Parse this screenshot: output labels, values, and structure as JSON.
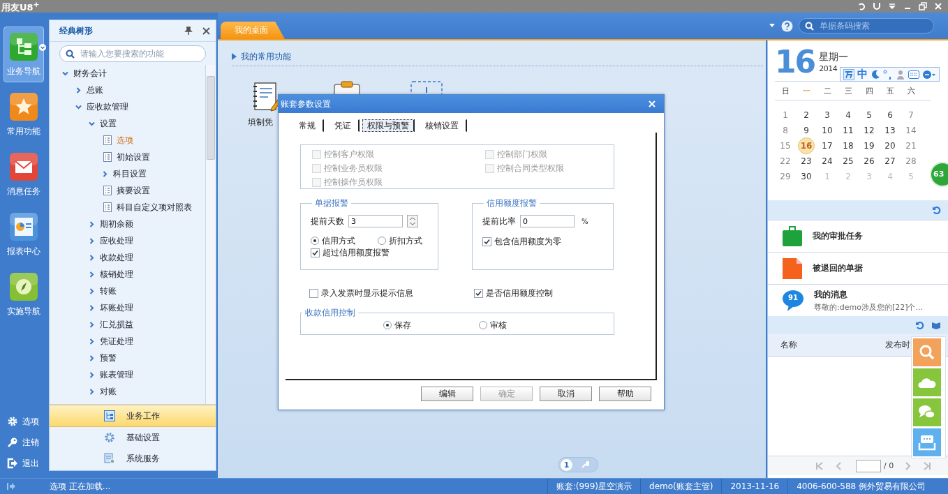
{
  "app": {
    "logo": "用友U8$^{+}$"
  },
  "left_rail": {
    "items": [
      {
        "label": "业务导航",
        "selected": true
      },
      {
        "label": "常用功能",
        "selected": false
      },
      {
        "label": "消息任务",
        "selected": false
      },
      {
        "label": "报表中心",
        "selected": false
      },
      {
        "label": "实施导航",
        "selected": false
      }
    ],
    "bottom": [
      {
        "label": "选项"
      },
      {
        "label": "注销"
      },
      {
        "label": "退出"
      }
    ]
  },
  "tree_panel": {
    "title": "经典树形",
    "search": {
      "placeholder": "请输入您要搜索的功能"
    },
    "tree": [
      {
        "label": "财务会计",
        "kind": "folder",
        "expanded": true,
        "selected": false,
        "children": [
          {
            "label": "总账",
            "kind": "folder",
            "expanded": false,
            "selected": false
          },
          {
            "label": "应收款管理",
            "kind": "folder",
            "expanded": true,
            "selected": false,
            "children": [
              {
                "label": "设置",
                "kind": "folder",
                "expanded": true,
                "selected": false,
                "children": [
                  {
                    "label": "选项",
                    "kind": "doc",
                    "selected": true
                  },
                  {
                    "label": "初始设置",
                    "kind": "doc",
                    "selected": false
                  },
                  {
                    "label": "科目设置",
                    "kind": "folder",
                    "expanded": false,
                    "selected": false
                  },
                  {
                    "label": "摘要设置",
                    "kind": "doc",
                    "selected": false
                  },
                  {
                    "label": "科目自定义项对照表",
                    "kind": "doc",
                    "selected": false
                  }
                ]
              },
              {
                "label": "期初余额",
                "kind": "folder",
                "expanded": false,
                "selected": false
              },
              {
                "label": "应收处理",
                "kind": "folder",
                "expanded": false,
                "selected": false
              },
              {
                "label": "收款处理",
                "kind": "folder",
                "expanded": false,
                "selected": false
              },
              {
                "label": "核销处理",
                "kind": "folder",
                "expanded": false,
                "selected": false
              },
              {
                "label": "转账",
                "kind": "folder",
                "expanded": false,
                "selected": false
              },
              {
                "label": "坏账处理",
                "kind": "folder",
                "expanded": false,
                "selected": false
              },
              {
                "label": "汇兑损益",
                "kind": "folder",
                "expanded": false,
                "selected": false
              },
              {
                "label": "凭证处理",
                "kind": "folder",
                "expanded": false,
                "selected": false
              },
              {
                "label": "预警",
                "kind": "folder",
                "expanded": false,
                "selected": false
              },
              {
                "label": "账表管理",
                "kind": "folder",
                "expanded": false,
                "selected": false
              },
              {
                "label": "对账",
                "kind": "folder",
                "expanded": false,
                "selected": false
              }
            ]
          }
        ]
      }
    ],
    "sections": [
      {
        "label": "业务工作",
        "selected": true
      },
      {
        "label": "基础设置",
        "selected": false
      },
      {
        "label": "系统服务",
        "selected": false
      }
    ]
  },
  "top_bar": {
    "tabs": [
      {
        "label": "我的桌面",
        "selected": true
      }
    ],
    "search": {
      "placeholder": "单据条码搜索"
    }
  },
  "desktop": {
    "header": "我的常用功能",
    "shortcuts": [
      {
        "kind": "document",
        "label": "填制凭"
      },
      {
        "kind": "clipboard"
      },
      {
        "kind": "empty-slot"
      }
    ],
    "pages": [
      {
        "label": "1",
        "selected": true
      }
    ]
  },
  "calendar": {
    "day": "16",
    "weekday": "星期一",
    "month": "2014",
    "weekdays": [
      {
        "label": "日",
        "today": false
      },
      {
        "label": "一",
        "today": true
      },
      {
        "label": "二",
        "today": false
      },
      {
        "label": "三",
        "today": false
      },
      {
        "label": "四",
        "today": false
      },
      {
        "label": "五",
        "today": false
      },
      {
        "label": "六",
        "today": false
      }
    ],
    "days": [
      {
        "label": "1",
        "in_month": true,
        "selected": false
      },
      {
        "label": "2",
        "in_month": true,
        "selected": false
      },
      {
        "label": "3",
        "in_month": true,
        "selected": false
      },
      {
        "label": "4",
        "in_month": true,
        "selected": false
      },
      {
        "label": "5",
        "in_month": true,
        "selected": false
      },
      {
        "label": "6",
        "in_month": true,
        "selected": false
      },
      {
        "label": "7",
        "in_month": true,
        "selected": false
      },
      {
        "label": "8",
        "in_month": true,
        "selected": false
      },
      {
        "label": "9",
        "in_month": true,
        "selected": false
      },
      {
        "label": "10",
        "in_month": true,
        "selected": false
      },
      {
        "label": "11",
        "in_month": true,
        "selected": false
      },
      {
        "label": "12",
        "in_month": true,
        "selected": false
      },
      {
        "label": "13",
        "in_month": true,
        "selected": false
      },
      {
        "label": "14",
        "in_month": true,
        "selected": false
      },
      {
        "label": "15",
        "in_month": true,
        "selected": false
      },
      {
        "label": "16",
        "in_month": true,
        "selected": true
      },
      {
        "label": "17",
        "in_month": true,
        "selected": false
      },
      {
        "label": "18",
        "in_month": true,
        "selected": false
      },
      {
        "label": "19",
        "in_month": true,
        "selected": false
      },
      {
        "label": "20",
        "in_month": true,
        "selected": false
      },
      {
        "label": "21",
        "in_month": true,
        "selected": false
      },
      {
        "label": "22",
        "in_month": true,
        "selected": false
      },
      {
        "label": "23",
        "in_month": true,
        "selected": false
      },
      {
        "label": "24",
        "in_month": true,
        "selected": false
      },
      {
        "label": "25",
        "in_month": true,
        "selected": false
      },
      {
        "label": "26",
        "in_month": true,
        "selected": false
      },
      {
        "label": "27",
        "in_month": true,
        "selected": false
      },
      {
        "label": "28",
        "in_month": true,
        "selected": false
      },
      {
        "label": "29",
        "in_month": true,
        "selected": false
      },
      {
        "label": "30",
        "in_month": true,
        "selected": false
      },
      {
        "label": "1",
        "in_month": false,
        "selected": false
      },
      {
        "label": "2",
        "in_month": false,
        "selected": false
      },
      {
        "label": "3",
        "in_month": false,
        "selected": false
      },
      {
        "label": "4",
        "in_month": false,
        "selected": false
      },
      {
        "label": "5",
        "in_month": false,
        "selected": false
      }
    ]
  },
  "ime_bar": {
    "mode": "中"
  },
  "float_badge": "63",
  "tasks": [
    {
      "kind": "approval",
      "title": "我的审批任务"
    },
    {
      "kind": "returned",
      "title": "被退回的单据"
    },
    {
      "kind": "message",
      "title": "我的消息",
      "count": "91",
      "subtitle": "尊敬的:demo涉及您的[22]个..."
    }
  ],
  "notices": {
    "columns": [
      "名称",
      "发布时"
    ],
    "total": "/ 0"
  },
  "dialog": {
    "title": "账套参数设置",
    "tabs": [
      {
        "label": "常规",
        "selected": false
      },
      {
        "label": "凭证",
        "selected": false
      },
      {
        "label": "权限与预警",
        "selected": true
      },
      {
        "label": "核销设置",
        "selected": false
      }
    ],
    "permissions": [
      {
        "label": "控制客户权限",
        "checked": false,
        "disabled": true
      },
      {
        "label": "控制部门权限",
        "checked": false,
        "disabled": true
      },
      {
        "label": "控制业务员权限",
        "checked": false,
        "disabled": true
      },
      {
        "label": "控制合同类型权限",
        "checked": false,
        "disabled": true
      },
      {
        "label": "控制操作员权限",
        "checked": false,
        "disabled": true
      }
    ],
    "doc_alert": {
      "title": "单据报警",
      "field_label": "提前天数",
      "value": "3",
      "radios": [
        {
          "label": "信用方式",
          "selected": true
        },
        {
          "label": "折扣方式",
          "selected": false
        }
      ],
      "check": {
        "label": "超过信用额度报警",
        "checked": true
      }
    },
    "credit_alert": {
      "title": "信用额度报警",
      "field_label": "提前比率",
      "value": "0",
      "unit": "%",
      "check": {
        "label": "包含信用额度为零",
        "checked": true
      }
    },
    "options": [
      {
        "label": "录入发票时显示提示信息",
        "checked": false
      },
      {
        "label": "是否信用额度控制",
        "checked": true
      }
    ],
    "receipt_control": {
      "title": "收款信用控制",
      "radios": [
        {
          "label": "保存",
          "selected": true
        },
        {
          "label": "审核",
          "selected": false
        }
      ]
    },
    "buttons": [
      {
        "label": "编辑",
        "disabled": false
      },
      {
        "label": "确定",
        "disabled": true
      },
      {
        "label": "取消",
        "disabled": false
      },
      {
        "label": "帮助",
        "disabled": false
      }
    ]
  },
  "status_bar": {
    "message": "选项 正在加载...",
    "fields": [
      "账套:(999)星空演示",
      "demo(账套主管)",
      "2013-11-16",
      "4006-600-588 例外贸易有限公司"
    ]
  }
}
